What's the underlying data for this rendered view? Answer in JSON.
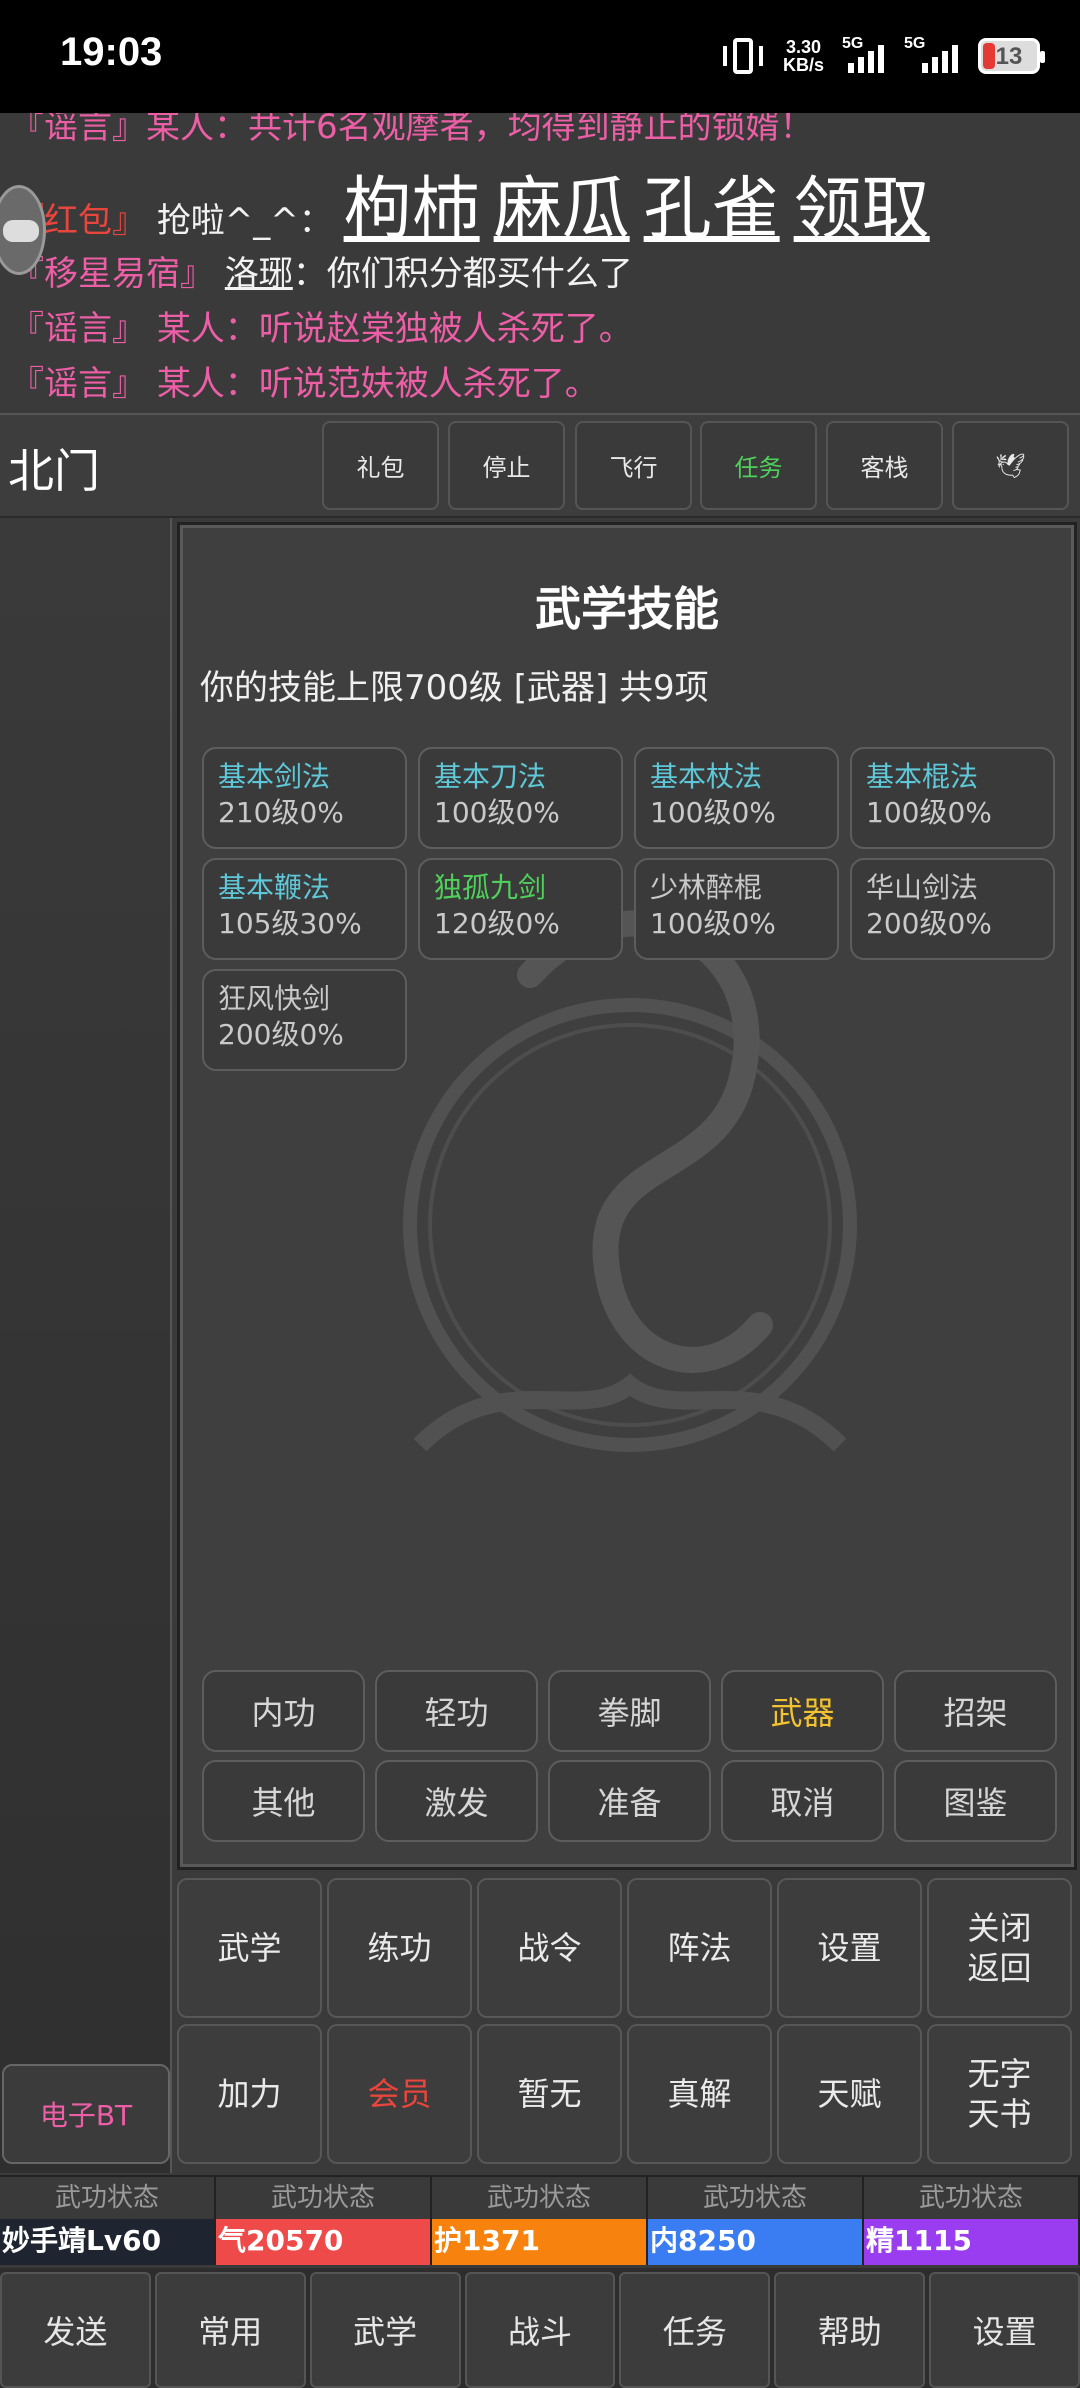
{
  "status_bar": {
    "time": "19:03",
    "speed": "3.30",
    "speed_unit": "KB/s",
    "net1": "5G",
    "net2": "5G",
    "battery": "13"
  },
  "chat": {
    "line0": "『谣言』某人：共计6名观摩者，均得到静止的锁婿！",
    "line1": {
      "tag": "『红包』",
      "speaker": "抢啦^_^：",
      "words": [
        "枸杮",
        "麻瓜",
        "孔雀",
        "领取"
      ]
    },
    "line2": {
      "tag": "『移星易宿』",
      "speaker": "洛琊",
      "text": "：你们积分都买什么了"
    },
    "line3": {
      "tag": "『谣言』",
      "speaker": "某人：",
      "text": "听说赵棠独被人杀死了。"
    },
    "line4": {
      "tag": "『谣言』",
      "speaker": "某人：",
      "text": "听说范妋被人杀死了。"
    }
  },
  "location": "北门",
  "top_buttons": [
    "礼包",
    "停止",
    "飞行",
    "任务",
    "客栈",
    "🕊"
  ],
  "panel": {
    "title": "武学技能",
    "subtitle": "你的技能上限700级 [武器] 共9项",
    "skills": [
      {
        "name": "基本剑法",
        "level": "210级0%"
      },
      {
        "name": "基本刀法",
        "level": "100级0%"
      },
      {
        "name": "基本杖法",
        "level": "100级0%"
      },
      {
        "name": "基本棍法",
        "level": "100级0%"
      },
      {
        "name": "基本鞭法",
        "level": "105级30%"
      },
      {
        "name": "独孤九剑",
        "level": "120级0%"
      },
      {
        "name": "少林醉棍",
        "level": "100级0%"
      },
      {
        "name": "华山剑法",
        "level": "200级0%"
      },
      {
        "name": "狂风快剑",
        "level": "200级0%"
      }
    ],
    "tabs": [
      "内功",
      "轻功",
      "拳脚",
      "武器",
      "招架",
      "其他",
      "激发",
      "准备",
      "取消",
      "图鉴"
    ],
    "active_tab": "武器"
  },
  "left_button": "电子BT",
  "actions": [
    "武学",
    "练功",
    "战令",
    "阵法",
    "设置",
    "关闭\n返回",
    "加力",
    "会员",
    "暂无",
    "真解",
    "天赋",
    "无字\n天书"
  ],
  "states": [
    "武功状态",
    "武功状态",
    "武功状态",
    "武功状态",
    "武功状态"
  ],
  "bars": [
    "妙手靖Lv60",
    "气20570",
    "护1371",
    "内8250",
    "精1115"
  ],
  "nav": [
    "发送",
    "常用",
    "武学",
    "战斗",
    "任务",
    "帮助",
    "设置"
  ],
  "colors": {
    "rumor": "#ec5fa7",
    "redpacket": "#e8453c",
    "skill_basic": "#5fc8d8",
    "skill_special": "#4fd05a",
    "active_tab": "#f2c230"
  }
}
